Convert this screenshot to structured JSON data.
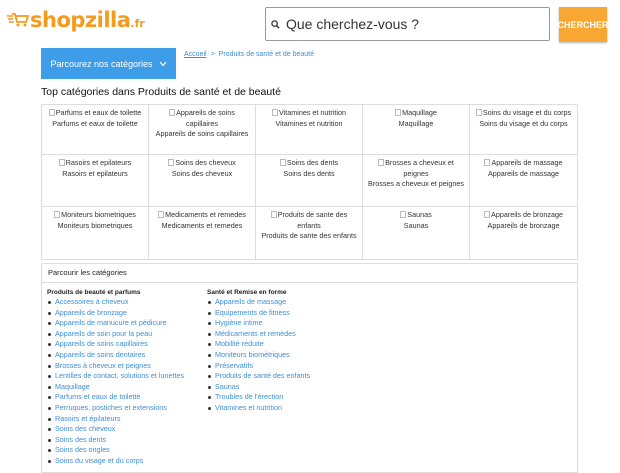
{
  "logo": {
    "name": "shopzilla",
    "tld": ".fr"
  },
  "search": {
    "placeholder": "Que cherchez-vous ?",
    "button": "CHERCHER"
  },
  "browse": {
    "label": "Parcourez nos catégories"
  },
  "breadcrumb": {
    "home": "Accueil",
    "sep": ">",
    "current": "Produits de santé et de beauté"
  },
  "heading": "Top catégories dans Produits de santé et de beauté",
  "top_categories": [
    {
      "img": "Parfums et eaux de toilette",
      "label": "Parfums et eaux de toilette"
    },
    {
      "img": "Appareils de soins capillaires",
      "label": "Appareils de soins capillaires"
    },
    {
      "img": "Vitamines et nutrition",
      "label": "Vitamines et nutrition"
    },
    {
      "img": "Maquillage",
      "label": "Maquillage"
    },
    {
      "img": "Soins du visage et du corps",
      "label": "Soins du visage et du corps"
    },
    {
      "img": "Rasoirs et epilateurs",
      "label": "Rasoirs et epilateurs"
    },
    {
      "img": "Soins des cheveux",
      "label": "Soins des cheveux"
    },
    {
      "img": "Soins des dents",
      "label": "Soins des dents"
    },
    {
      "img": "Brosses a cheveux et peignes",
      "label": "Brosses a cheveux et peignes"
    },
    {
      "img": "Appareils de massage",
      "label": "Appareils de massage"
    },
    {
      "img": "Moniteurs biometriques",
      "label": "Moniteurs biometriques"
    },
    {
      "img": "Medicaments et remedes",
      "label": "Medicaments et remedes"
    },
    {
      "img": "Produits de sante des enfants",
      "label": "Produits de sante des enfants"
    },
    {
      "img": "Saunas",
      "label": "Saunas"
    },
    {
      "img": "Appareils de bronzage",
      "label": "Appareils de bronzage"
    }
  ],
  "browse_panel": {
    "title": "Parcourir les catégories",
    "col1": {
      "heading": "Produits de beauté et parfums",
      "items": [
        "Accessoires à cheveux",
        "Appareils de bronzage",
        "Appareils de manucure et pédicure",
        "Appareils de soin pour la peau",
        "Appareils de soins capillaires",
        "Appareils de soins dentaires",
        "Brosses à cheveux et peignes",
        "Lentilles de contact, solutions et lunettes",
        "Maquillage",
        "Parfums et eaux de toilette",
        "Perruques, postiches et extensions",
        "Rasoirs et épilateurs",
        "Soins des cheveux",
        "Soins des dents",
        "Soins des ongles",
        "Soins du visage et du corps"
      ]
    },
    "col2": {
      "heading": "Santé et Remise en forme",
      "items": [
        "Appareils de massage",
        "Equipements de fitness",
        "Hygiène intime",
        "Médicaments et remèdes",
        "Mobilité réduite",
        "Moniteurs biométriques",
        "Préservatifs",
        "Produits de santé des enfants",
        "Saunas",
        "Troubles de l'érection",
        "Vitamines et nutrition"
      ]
    }
  },
  "colors": {
    "accent": "#f9a733",
    "blue": "#3d9de8",
    "link": "#3d8fd8"
  }
}
